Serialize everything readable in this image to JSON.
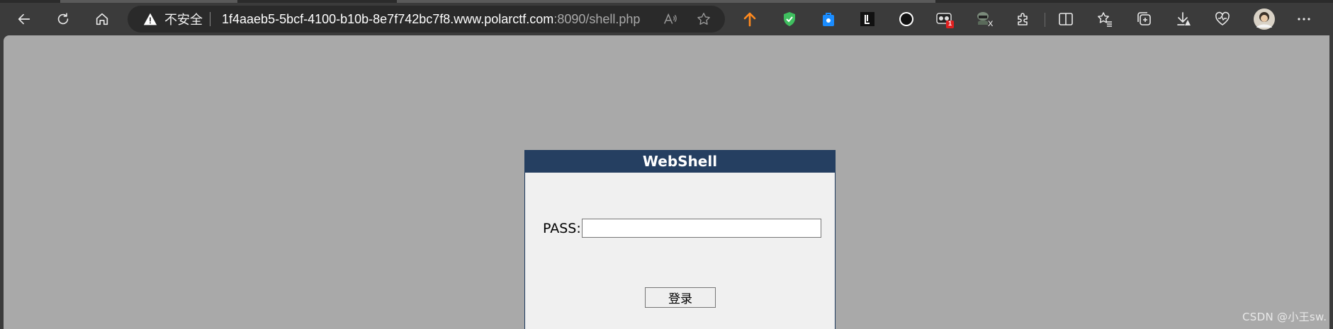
{
  "browser": {
    "security_label": "不安全",
    "url_host": "1f4aaeb5-5bcf-4100-b10b-8e7f742bc7f8.www.polarctf.com",
    "url_rest": ":8090/shell.php",
    "nav_icons": [
      "back-icon",
      "refresh-icon",
      "home-icon"
    ],
    "omnibox_icons": [
      "warning-icon",
      "read-aloud-icon",
      "favorite-star-icon"
    ],
    "extension_icons": [
      "orange-arrow-extension-icon",
      "green-shield-extension-icon",
      "blue-bag-extension-icon",
      "black-square-extension-icon",
      "black-circle-extension-icon",
      "glasses-badge-extension-icon",
      "hacker-extension-icon",
      "extensions-puzzle-icon",
      "split-screen-icon",
      "favorites-icon",
      "collections-icon",
      "downloads-icon",
      "browser-health-icon",
      "profile-avatar",
      "more-menu-icon"
    ],
    "ext_badge": "1",
    "ext_badge2": "X",
    "colors": {
      "toolbar": "#3b3b3b",
      "omnibox": "#2a2a2a",
      "page_bg": "#a9a9a9",
      "accent_orange": "#ff8a1f",
      "accent_green": "#3fbf5f",
      "accent_blue": "#1a8cff"
    }
  },
  "page": {
    "header_title": "WebShell",
    "pass_label": "PASS:",
    "pass_value": "",
    "login_label": "登录",
    "colors": {
      "header_bg": "#253f61",
      "panel_bg": "#f0f0f0"
    }
  },
  "watermark": "CSDN @小王sw."
}
